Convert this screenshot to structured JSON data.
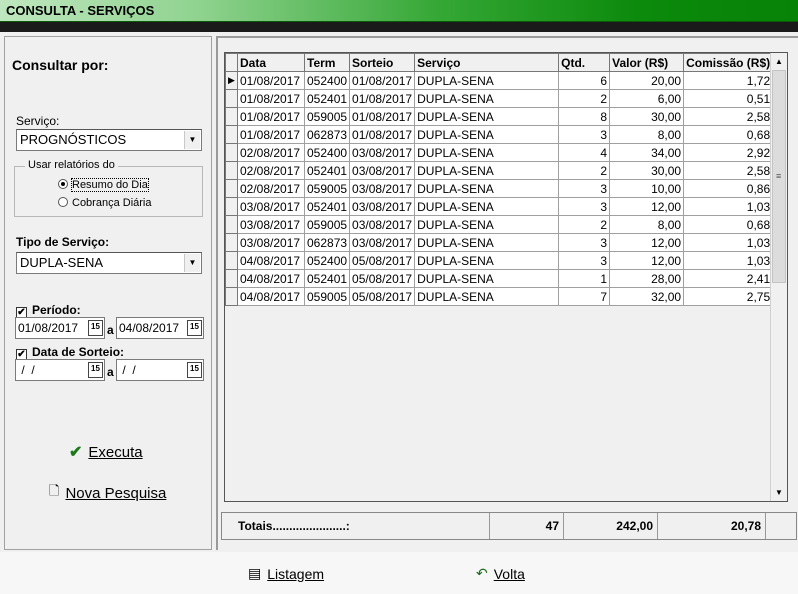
{
  "window": {
    "title": "CONSULTA - SERVIÇOS"
  },
  "left": {
    "consultar_por": "Consultar por:",
    "servico_label": "Serviço:",
    "servico_value": "PROGNÓSTICOS",
    "relatorios_legend": "Usar relatórios do",
    "radio_resumo": "Resumo do Dia",
    "radio_cobranca": "Cobrança Diária",
    "radio_selected": "resumo",
    "tipo_label": "Tipo de Serviço:",
    "tipo_value": "DUPLA-SENA",
    "periodo_label": "Período:",
    "periodo_checked": true,
    "periodo_from": "01/08/2017",
    "periodo_to": "04/08/2017",
    "a_sep": "a",
    "sorteio_label": "Data de Sorteio:",
    "sorteio_checked": true,
    "sorteio_from": " /  /",
    "sorteio_to": " /  /",
    "cal_glyph": "15",
    "executa_label": "Executa",
    "nova_label": "Nova Pesquisa"
  },
  "grid": {
    "headers": [
      "Data",
      "Term",
      "Sorteio",
      "Serviço",
      "Qtd.",
      "Valor (R$)",
      "Comissão (R$)"
    ],
    "rows": [
      [
        "01/08/2017",
        "052400",
        "01/08/2017",
        "DUPLA-SENA",
        "6",
        "20,00",
        "1,72"
      ],
      [
        "01/08/2017",
        "052401",
        "01/08/2017",
        "DUPLA-SENA",
        "2",
        "6,00",
        "0,51"
      ],
      [
        "01/08/2017",
        "059005",
        "01/08/2017",
        "DUPLA-SENA",
        "8",
        "30,00",
        "2,58"
      ],
      [
        "01/08/2017",
        "062873",
        "01/08/2017",
        "DUPLA-SENA",
        "3",
        "8,00",
        "0,68"
      ],
      [
        "02/08/2017",
        "052400",
        "03/08/2017",
        "DUPLA-SENA",
        "4",
        "34,00",
        "2,92"
      ],
      [
        "02/08/2017",
        "052401",
        "03/08/2017",
        "DUPLA-SENA",
        "2",
        "30,00",
        "2,58"
      ],
      [
        "02/08/2017",
        "059005",
        "03/08/2017",
        "DUPLA-SENA",
        "3",
        "10,00",
        "0,86"
      ],
      [
        "03/08/2017",
        "052401",
        "03/08/2017",
        "DUPLA-SENA",
        "3",
        "12,00",
        "1,03"
      ],
      [
        "03/08/2017",
        "059005",
        "03/08/2017",
        "DUPLA-SENA",
        "2",
        "8,00",
        "0,68"
      ],
      [
        "03/08/2017",
        "062873",
        "03/08/2017",
        "DUPLA-SENA",
        "3",
        "12,00",
        "1,03"
      ],
      [
        "04/08/2017",
        "052400",
        "05/08/2017",
        "DUPLA-SENA",
        "3",
        "12,00",
        "1,03"
      ],
      [
        "04/08/2017",
        "052401",
        "05/08/2017",
        "DUPLA-SENA",
        "1",
        "28,00",
        "2,41"
      ],
      [
        "04/08/2017",
        "059005",
        "05/08/2017",
        "DUPLA-SENA",
        "7",
        "32,00",
        "2,75"
      ]
    ]
  },
  "totals": {
    "label": "Totais......................:",
    "qtd": "47",
    "valor": "242,00",
    "comissao": "20,78"
  },
  "footer": {
    "listagem_label": "Listagem",
    "volta_label": "Volta"
  },
  "icons": {
    "selected_row": "row-pointer-icon",
    "executa": "checkmark-icon",
    "nova": "page-icon",
    "listagem": "table-icon",
    "volta": "undo-arrow-icon",
    "scroll_grip": "grip-icon"
  },
  "colors": {
    "title_gradient_end": "#078307",
    "checkmark": "#1a7a1a"
  }
}
